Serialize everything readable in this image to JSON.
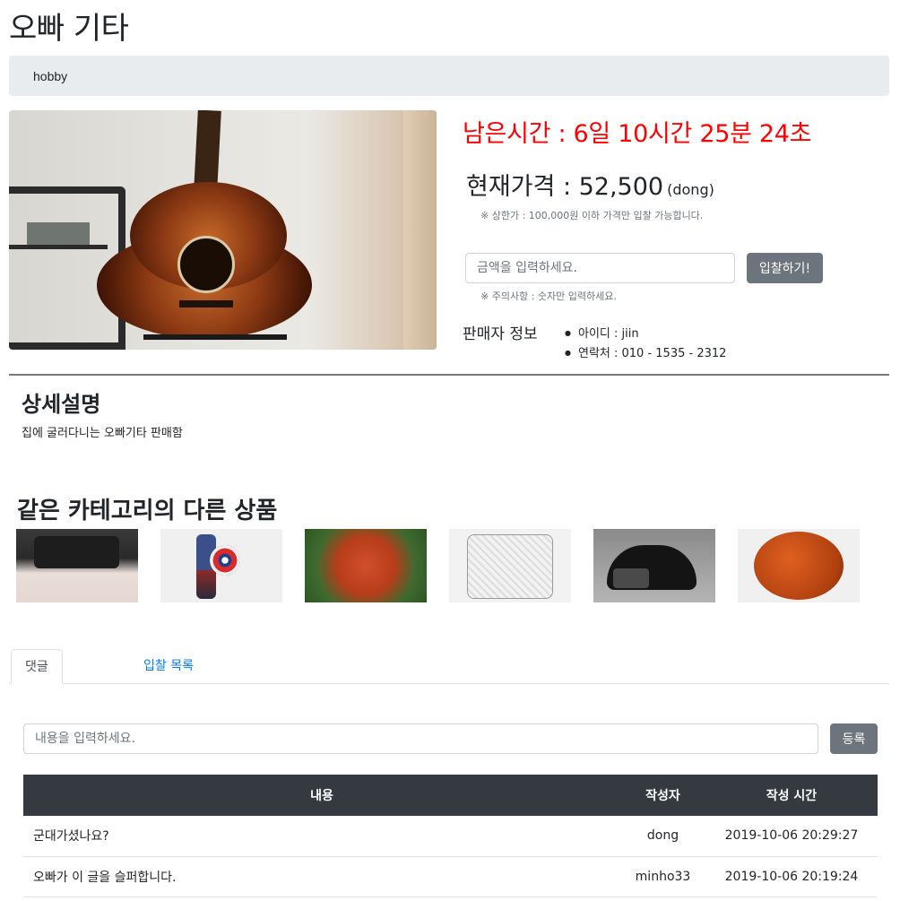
{
  "title": "오빠 기타",
  "breadcrumb": "hobby",
  "remaining_time": "남은시간 : 6일 10시간 25분 24초",
  "price": {
    "label": "현재가격 : 52,500",
    "unit": "(dong)",
    "note": "※ 상한가 : 100,000원 이하 가격만 입찰 가능합니다."
  },
  "bid": {
    "placeholder": "금액을 입력하세요.",
    "button": "입찰하기!",
    "note": "※ 주의사항 : 숫자만 입력하세요."
  },
  "seller": {
    "label": "판매자 정보",
    "items": [
      "아이디 : jiin",
      "연락처 : 010 - 1535 - 2312"
    ]
  },
  "detail": {
    "title": "상세설명",
    "text": "집에 굴러다니는 오빠기타 판매함"
  },
  "related": {
    "title": "같은 카테고리의 다른 상품"
  },
  "tabs": [
    "댓글",
    "입찰 목록"
  ],
  "comment": {
    "placeholder": "내용을 입력하세요.",
    "button": "등록"
  },
  "table": {
    "headers": [
      "내용",
      "작성자",
      "작성 시간"
    ],
    "rows": [
      [
        "군대가셨나요?",
        "dong",
        "2019-10-06 20:29:27"
      ],
      [
        "오빠가 이 글을 슬퍼합니다.",
        "minho33",
        "2019-10-06 20:19:24"
      ]
    ]
  },
  "colors": {
    "remaining": "#ff0000",
    "button": "#6c757d",
    "table_header": "#343a40",
    "link": "#007bff"
  }
}
